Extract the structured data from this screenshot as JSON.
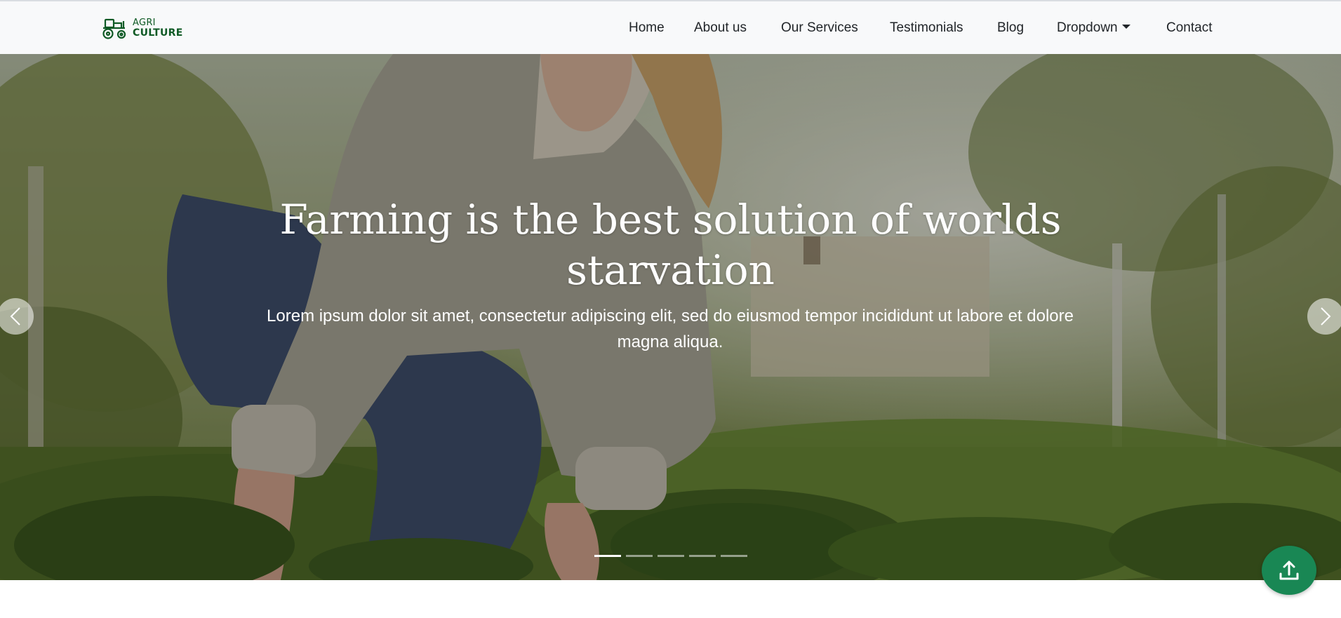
{
  "brand": {
    "line1": "AGRI",
    "line2": "CULTURE",
    "icon": "tractor-icon",
    "color": "#0f5a25"
  },
  "nav": {
    "items": [
      {
        "label": "Home"
      },
      {
        "label": "About us"
      },
      {
        "label": "Our Services"
      },
      {
        "label": "Testimonials"
      },
      {
        "label": "Blog"
      },
      {
        "label": "Dropdown",
        "icon": "caret-down-icon"
      },
      {
        "label": "Contact"
      }
    ]
  },
  "hero": {
    "headline": "Farming is the best solution of worlds starvation",
    "subtitle": "Lorem ipsum dolor sit amet, consectetur adipiscing elit, sed do eiusmod tempor incididunt ut labore et dolore magna aliqua.",
    "prev_icon": "chevron-left-icon",
    "next_icon": "chevron-right-icon",
    "slide_count": 5,
    "active_slide": 1
  },
  "scroll_top": {
    "icon": "upload-arrow-icon",
    "color": "#198754"
  }
}
